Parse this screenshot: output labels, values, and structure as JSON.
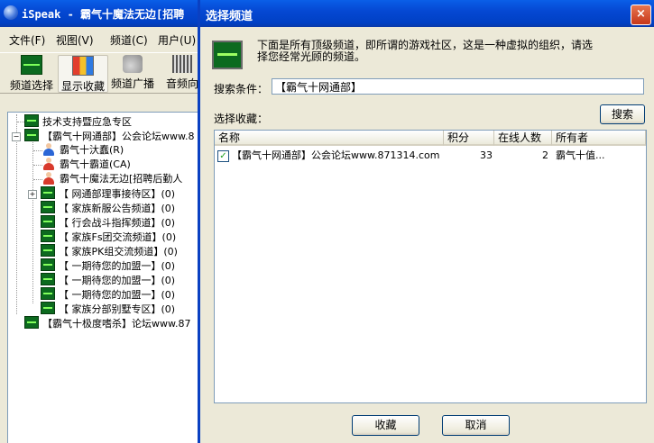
{
  "main_window": {
    "title": "iSpeak - 霸气十魔法无边[招聘",
    "menu": [
      "文件(F)",
      "视图(V)",
      "频道(C)",
      "用户(U)"
    ],
    "toolbar": [
      {
        "label": "频道选择",
        "icon": "channel-wave-icon"
      },
      {
        "label": "显示收藏",
        "icon": "favorites-book-icon"
      },
      {
        "label": "频道广播",
        "icon": "satellite-dish-icon"
      },
      {
        "label": "音频向",
        "icon": "audio-grid-icon"
      }
    ],
    "tree": [
      {
        "text": "技术支持暨应急专区",
        "kind": "channel"
      },
      {
        "text": "【霸气十网通部】公会论坛www.8",
        "kind": "channel"
      },
      {
        "text": "霸气十汏蠢(R)",
        "kind": "user-blue"
      },
      {
        "text": "霸气十霸道(CA)",
        "kind": "user-red"
      },
      {
        "text": "霸气十魔法无边[招聘后勤人",
        "kind": "user-red"
      },
      {
        "text": "【  网通部理事接待区】(0)",
        "kind": "channel"
      },
      {
        "text": "【  家族新服公告频道】(0)",
        "kind": "channel"
      },
      {
        "text": "【  行会战斗指挥频道】(0)",
        "kind": "channel"
      },
      {
        "text": "【  家族Fs团交流频道】(0)",
        "kind": "channel"
      },
      {
        "text": "【  家族PK组交流频道】(0)",
        "kind": "channel"
      },
      {
        "text": "【  一期待您的加盟一】(0)",
        "kind": "channel"
      },
      {
        "text": "【  一期待您的加盟一】(0)",
        "kind": "channel"
      },
      {
        "text": "【  一期待您的加盟一】(0)",
        "kind": "channel"
      },
      {
        "text": "【  家族分部别墅专区】(0)",
        "kind": "channel"
      },
      {
        "text": "【霸气十极度嗜杀】论坛www.87",
        "kind": "channel"
      }
    ]
  },
  "dialog": {
    "title": "选择频道",
    "close_label": "×",
    "description": "下面是所有顶级频道，即所谓的游戏社区，这是一种虚拟的组织，请选择您经常光顾的频道。",
    "search_label": "搜索条件：",
    "search_value": "【霸气十网通部】",
    "favorites_label": "选择收藏：",
    "search_button": "搜索",
    "columns": [
      "名称",
      "积分",
      "在线人数",
      "所有者"
    ],
    "rows": [
      {
        "checked": true,
        "check_mark": "✓",
        "name": "【霸气十网通部】公会论坛www.871314.com",
        "score": "33",
        "online": "2",
        "owner": "霸气十值..."
      }
    ],
    "ok_button": "收藏",
    "cancel_button": "取消"
  }
}
